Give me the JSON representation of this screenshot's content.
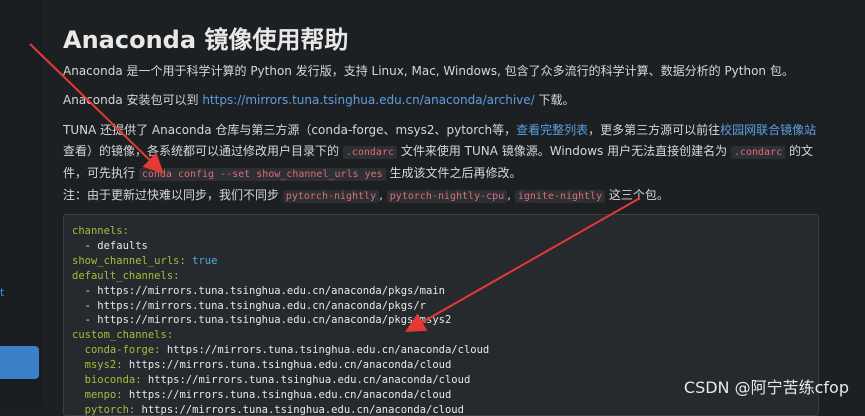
{
  "page": {
    "title": "Anaconda 镜像使用帮助",
    "side_link": "t",
    "p1": "Anaconda 是一个用于科学计算的 Python 发行版，支持 Linux, Mac, Windows, 包含了众多流行的科学计算、数据分析的 Python 包。",
    "p2_prefix": "Anaconda 安装包可以到 ",
    "p2_link": "https://mirrors.tuna.tsinghua.edu.cn/anaconda/archive/",
    "p2_suffix": " 下载。",
    "p3_a": "TUNA 还提供了 Anaconda 仓库与第三方源（conda-forge、msys2、pytorch等，",
    "p3_link1": "查看完整列表",
    "p3_b": "，更多第三方源可以前往",
    "p3_link2": "校园网联合镜像站",
    "p3_c": "查看）的镜像，各系统都可以通过修改用户目录下的 ",
    "p3_code1": ".condarc",
    "p3_d": " 文件来使用 TUNA 镜像源。Windows 用户无法直接创建名为 ",
    "p3_code2": ".condarc",
    "p3_e": " 的文件，可先执行 ",
    "p3_code3": "conda config --set show_channel_urls yes",
    "p3_f": " 生成该文件之后再修改。",
    "p4_a": "注：由于更新过快难以同步，我们不同步 ",
    "p4_code1": "pytorch-nightly",
    "p4_sep1": ", ",
    "p4_code2": "pytorch-nightly-cpu",
    "p4_sep2": ", ",
    "p4_code3": "ignite-nightly",
    "p4_b": " 这三个包。"
  },
  "code": {
    "l1_k": "channels:",
    "l2": "  - defaults",
    "l3_k": "show_channel_urls:",
    "l3_v": " true",
    "l4_k": "default_channels:",
    "l5": "  - https://mirrors.tuna.tsinghua.edu.cn/anaconda/pkgs/main",
    "l6": "  - https://mirrors.tuna.tsinghua.edu.cn/anaconda/pkgs/r",
    "l7": "  - https://mirrors.tuna.tsinghua.edu.cn/anaconda/pkgs/msys2",
    "l8_k": "custom_channels:",
    "l9_k": "  conda-forge:",
    "l9_v": " https://mirrors.tuna.tsinghua.edu.cn/anaconda/cloud",
    "l10_k": "  msys2:",
    "l10_v": " https://mirrors.tuna.tsinghua.edu.cn/anaconda/cloud",
    "l11_k": "  bioconda:",
    "l11_v": " https://mirrors.tuna.tsinghua.edu.cn/anaconda/cloud",
    "l12_k": "  menpo:",
    "l12_v": " https://mirrors.tuna.tsinghua.edu.cn/anaconda/cloud",
    "l13_k": "  pytorch:",
    "l13_v": " https://mirrors.tuna.tsinghua.edu.cn/anaconda/cloud"
  },
  "watermark": "CSDN @阿宁苦练cfop",
  "colors": {
    "background": "#1d2023",
    "link": "#5b9fe0",
    "inline_code": "#e06c75",
    "yaml_key": "#9ec23b",
    "arrow": "#e53935"
  }
}
